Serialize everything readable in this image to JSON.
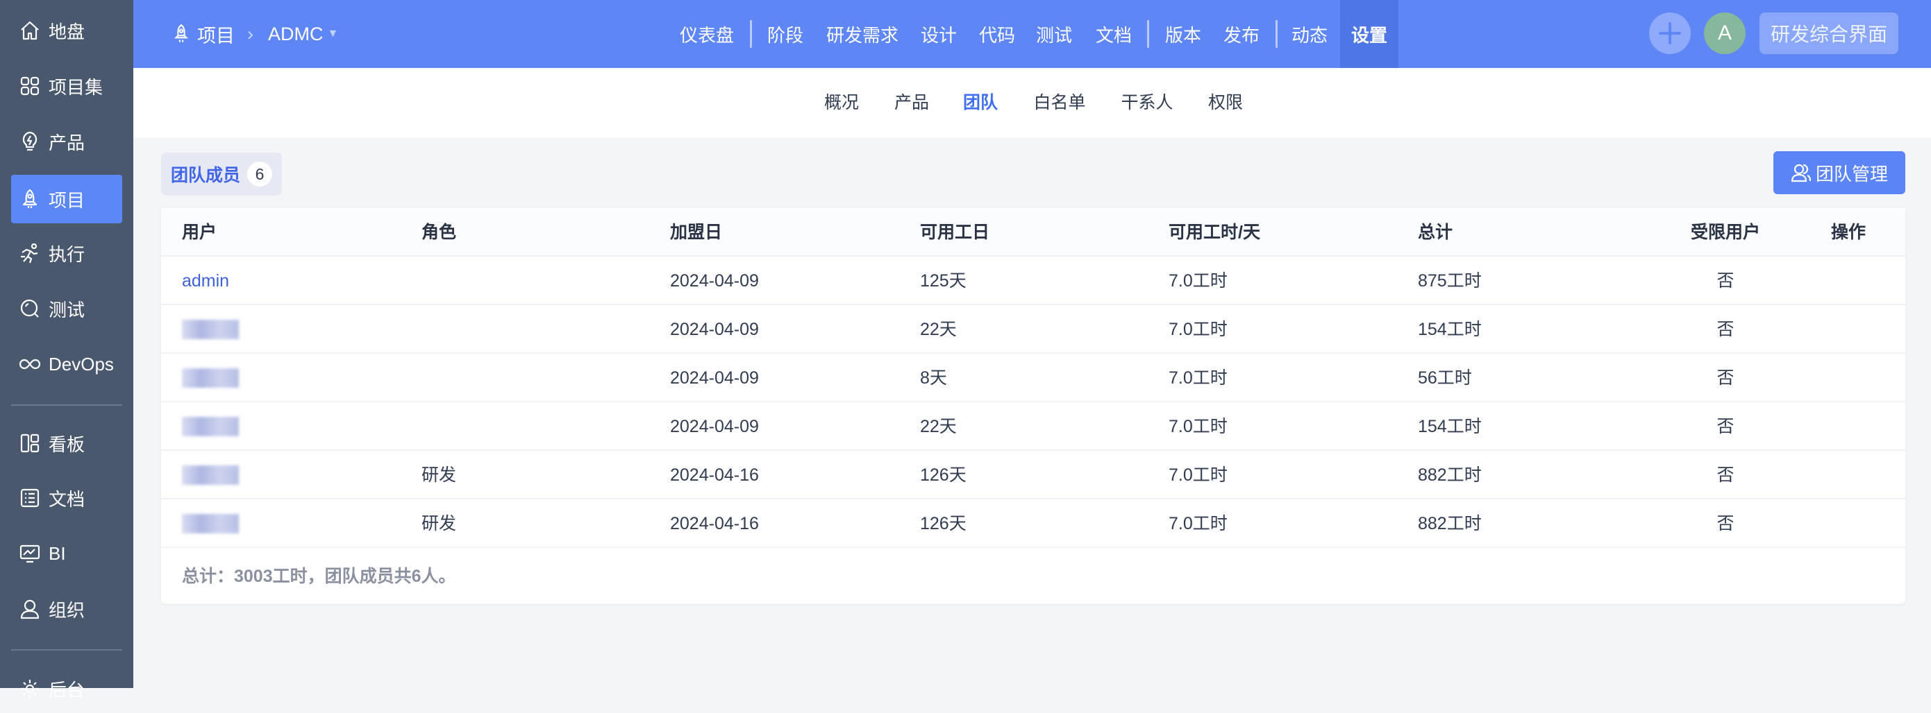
{
  "sidebar": {
    "items": [
      {
        "label": "地盘",
        "icon": "home-icon"
      },
      {
        "label": "项目集",
        "icon": "grid-icon"
      },
      {
        "label": "产品",
        "icon": "bulb-icon"
      },
      {
        "label": "项目",
        "icon": "rocket-icon",
        "active": true
      },
      {
        "label": "执行",
        "icon": "run-icon"
      },
      {
        "label": "测试",
        "icon": "search-icon"
      },
      {
        "label": "DevOps",
        "icon": "infinity-icon"
      },
      {
        "label": "看板",
        "icon": "board-icon"
      },
      {
        "label": "文档",
        "icon": "doc-icon"
      },
      {
        "label": "BI",
        "icon": "monitor-icon"
      },
      {
        "label": "组织",
        "icon": "user-icon"
      },
      {
        "label": "后台",
        "icon": "gear-icon"
      }
    ]
  },
  "topbar": {
    "breadcrumb_root": "项目",
    "breadcrumb_current": "ADMC",
    "nav": [
      "仪表盘",
      "阶段",
      "研发需求",
      "设计",
      "代码",
      "测试",
      "文档",
      "版本",
      "发布",
      "动态",
      "设置"
    ],
    "active_nav": "设置",
    "avatar_letter": "A",
    "switch_label": "研发综合界面"
  },
  "subnav": {
    "items": [
      "概况",
      "产品",
      "团队",
      "白名单",
      "干系人",
      "权限"
    ],
    "active": "团队"
  },
  "team": {
    "tab_label": "团队成员",
    "count": "6",
    "manage_label": "团队管理",
    "columns": [
      "用户",
      "角色",
      "加盟日",
      "可用工日",
      "可用工时/天",
      "总计",
      "受限用户",
      "操作"
    ],
    "rows": [
      {
        "user": "admin",
        "role": "",
        "join": "2024-04-09",
        "days": "125天",
        "hours": "7.0工时",
        "total": "875工时",
        "limited": "否"
      },
      {
        "user": "",
        "role": "",
        "join": "2024-04-09",
        "days": "22天",
        "hours": "7.0工时",
        "total": "154工时",
        "limited": "否"
      },
      {
        "user": "",
        "role": "",
        "join": "2024-04-09",
        "days": "8天",
        "hours": "7.0工时",
        "total": "56工时",
        "limited": "否"
      },
      {
        "user": "",
        "role": "",
        "join": "2024-04-09",
        "days": "22天",
        "hours": "7.0工时",
        "total": "154工时",
        "limited": "否"
      },
      {
        "user": "",
        "role": "研发",
        "join": "2024-04-16",
        "days": "126天",
        "hours": "7.0工时",
        "total": "882工时",
        "limited": "否"
      },
      {
        "user": "",
        "role": "研发",
        "join": "2024-04-16",
        "days": "126天",
        "hours": "7.0工时",
        "total": "882工时",
        "limited": "否"
      }
    ],
    "footer": "总计：3003工时，团队成员共6人。"
  },
  "colors": {
    "topbar": "#5e87f5",
    "sidebar": "#4a586e",
    "accent": "#5b84f6"
  }
}
